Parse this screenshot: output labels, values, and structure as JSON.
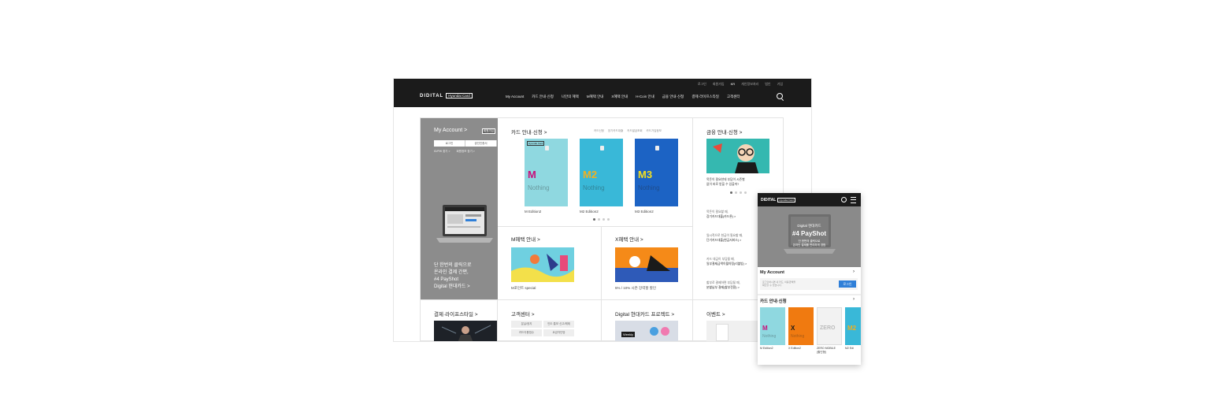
{
  "desktop": {
    "utility_links": [
      "로그인",
      "회원가입",
      "KR",
      "개인정보처리",
      "법인",
      "기업"
    ],
    "logo": {
      "word": "DIDITAL",
      "tag": "Hyundai Card"
    },
    "gnb": [
      "My Account",
      "카드 안내·신청",
      "나만의 혜택",
      "M혜택 안내",
      "X혜택 안내",
      "H-Coin 안내",
      "금융 안내·신청",
      "결제·라이프스타일",
      "고객센터"
    ],
    "account": {
      "title": "My Account >",
      "badge": "회원가입",
      "buttons": [
        "로그인",
        "공인인증서"
      ],
      "links": [
        "ID/PW 찾기 >",
        "회원정보 찾기 >"
      ],
      "copy": "단 한번의 클릭으로\n온라인 결제 간편,\n#4 PayShot\nDigital 현대카드 >"
    },
    "cards": {
      "title": "카드 안내·신청 >",
      "sublinks": [
        "카드신청",
        "장기카드대출",
        "카드발급조회",
        "카드가입정보"
      ],
      "items": [
        {
          "label": "M",
          "note": "Nothing",
          "name": "M Edition2",
          "bg": "#8fd8e0",
          "fg": "#c8107a"
        },
        {
          "label": "M2",
          "note": "Nothing",
          "name": "M2 Edition2",
          "bg": "#39b8d8",
          "fg": "#f0b020"
        },
        {
          "label": "M3",
          "note": "Nothing",
          "name": "M3 Edition2",
          "bg": "#1c63c4",
          "fg": "#f4e020"
        }
      ]
    },
    "m_benefit": {
      "title": "M혜택 안내 >",
      "caption": "M포인트 special"
    },
    "x_benefit": {
      "title": "X혜택 안내 >",
      "caption": "5% / 10% 시즌 강력할 할인"
    },
    "finance": {
      "title": "금융 안내·신청 >",
      "caption": "목돈이 필요한데 부담이 시즌별\n없이 바로 받을 수 있을까?",
      "items": [
        {
          "small": "목돈이 필요할 때,",
          "main": "장기카드대출(카드론) >"
        },
        {
          "small": "일시적으로 현금이 필요할 때,",
          "main": "단기카드대출(현금서비스) >"
        },
        {
          "small": "카드 대금이 부담될 때,",
          "main": "일부결제금액이월약정(리볼빙) >"
        },
        {
          "small": "할부로 결제하면 부담될 때,",
          "main": "분할납부 결제(할부전환) >"
        }
      ]
    },
    "lifestyle": {
      "title": "결제·라이프스타일 >"
    },
    "cs": {
      "title": "고객센터 >",
      "buttons": [
        "분실/정지",
        "인도·통보 신고/해제",
        "카드이용접수",
        "요금차단망"
      ]
    },
    "project": {
      "title": "Digital 현대카드 프로젝트 >",
      "tag": "Weekly"
    },
    "event": {
      "title": "이벤트 >"
    }
  },
  "mobile": {
    "logo": {
      "word": "DIDITAL",
      "tag": "Hyundai Card"
    },
    "hero": {
      "line1": "Digital 현대카드",
      "line2": "#4 PayShot",
      "line3": "단 한번의 클릭으로\n온라인 결제를 편리하게 경험"
    },
    "account": {
      "title": "My Account",
      "hint": "로그인하시면 내 카드, 이용금액을\n확인할 수 있습니다.",
      "login": "로그인"
    },
    "cards": {
      "title": "카드 안내·신청",
      "items": [
        {
          "label": "M",
          "note": "Nothing",
          "name": "M Edition2",
          "bg": "#8fd8e0",
          "fg": "#c8107a"
        },
        {
          "label": "X",
          "note": "Nothing",
          "name": "X Edition2",
          "bg": "#f07a10",
          "fg": "#1b1b1b"
        },
        {
          "label": "ZERO",
          "note": "",
          "name": "ZERO MOBILE\n(할인형)",
          "bg": "#f2f2f2",
          "fg": "#bbbbbb"
        },
        {
          "label": "M2",
          "note": "",
          "name": "M2 Edi",
          "bg": "#39b8d8",
          "fg": "#f0b020"
        }
      ]
    }
  }
}
